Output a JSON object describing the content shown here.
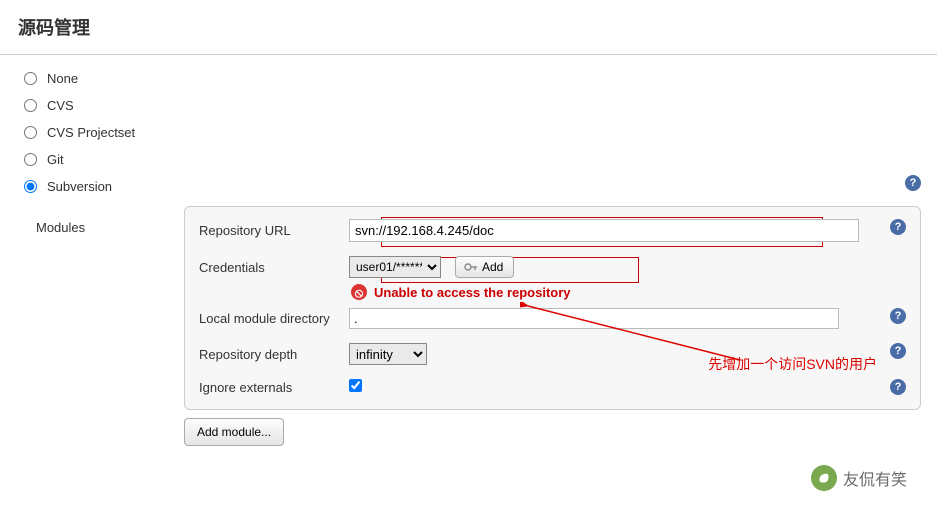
{
  "heading": "源码管理",
  "scm_options": {
    "none": "None",
    "cvs": "CVS",
    "cvs_projectset": "CVS Projectset",
    "git": "Git",
    "subversion": "Subversion"
  },
  "selected_scm": "subversion",
  "modules_label": "Modules",
  "fields": {
    "repo_url_label": "Repository URL",
    "repo_url_value": "svn://192.168.4.245/doc",
    "credentials_label": "Credentials",
    "credentials_selected": "user01/******",
    "add_label": "Add",
    "error_text": "Unable to access the repository",
    "local_dir_label": "Local module directory",
    "local_dir_value": ".",
    "depth_label": "Repository depth",
    "depth_value": "infinity",
    "ignore_externals_label": "Ignore externals"
  },
  "buttons": {
    "add_module": "Add module..."
  },
  "annotation": "先增加一个访问SVN的用户",
  "watermark_text": "友侃有笑"
}
